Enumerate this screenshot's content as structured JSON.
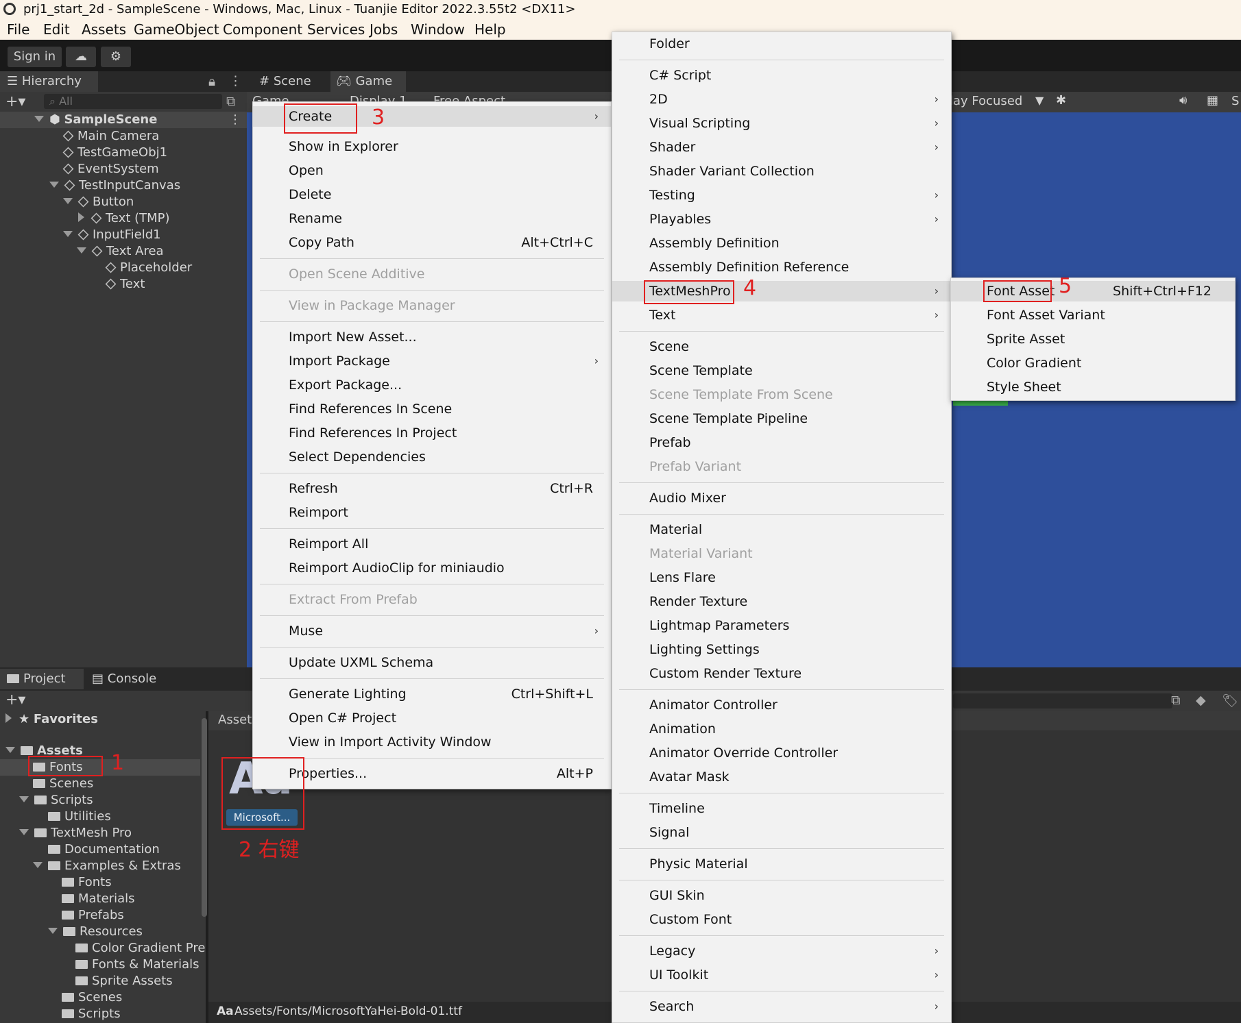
{
  "window": {
    "title": "prj1_start_2d - SampleScene - Windows, Mac, Linux - Tuanjie Editor 2022.3.55t2 <DX11>"
  },
  "menubar": [
    "File",
    "Edit",
    "Assets",
    "GameObject",
    "Component",
    "Services",
    "Jobs",
    "Window",
    "Help"
  ],
  "toolbar": {
    "sign_in": "Sign in"
  },
  "hierarchy": {
    "tab": "Hierarchy",
    "search_placeholder": "All",
    "items": [
      "SampleScene",
      "Main Camera",
      "TestGameObj1",
      "EventSystem",
      "TestInputCanvas",
      "Button",
      "Text (TMP)",
      "InputField1",
      "Text Area",
      "Placeholder",
      "Text"
    ]
  },
  "scene_tabs": {
    "scene": "Scene",
    "game": "Game",
    "game_dropdown": "Game",
    "display": "Display 1",
    "aspect": "Free Aspect",
    "play_focused": "lay Focused",
    "s": "S"
  },
  "project": {
    "tabs": [
      "Project",
      "Console"
    ],
    "favorites": "Favorites",
    "tree": [
      "Assets",
      "Fonts",
      "Scenes",
      "Scripts",
      "Utilities",
      "TextMesh Pro",
      "Documentation",
      "Examples & Extras",
      "Fonts",
      "Materials",
      "Prefabs",
      "Resources",
      "Color Gradient Pre",
      "Fonts & Materials",
      "Sprite Assets",
      "Scenes",
      "Scripts"
    ],
    "breadcrumb": "Asset",
    "asset_glyph": "Aa",
    "asset_name": "Microsoft...",
    "status_icon": "Aa",
    "status_path": "Assets/Fonts/MicrosoftYaHei-Bold-01.ttf"
  },
  "context_menu": {
    "items": [
      {
        "label": "Create",
        "arrow": true
      },
      {
        "label": "Show in Explorer"
      },
      {
        "label": "Open"
      },
      {
        "label": "Delete"
      },
      {
        "label": "Rename"
      },
      {
        "label": "Copy Path",
        "shortcut": "Alt+Ctrl+C"
      },
      {
        "label": "Open Scene Additive",
        "disabled": true
      },
      {
        "label": "View in Package Manager",
        "disabled": true
      },
      {
        "label": "Import New Asset..."
      },
      {
        "label": "Import Package",
        "arrow": true
      },
      {
        "label": "Export Package..."
      },
      {
        "label": "Find References In Scene"
      },
      {
        "label": "Find References In Project"
      },
      {
        "label": "Select Dependencies"
      },
      {
        "label": "Refresh",
        "shortcut": "Ctrl+R"
      },
      {
        "label": "Reimport"
      },
      {
        "label": "Reimport All"
      },
      {
        "label": "Reimport AudioClip for miniaudio"
      },
      {
        "label": "Extract From Prefab",
        "disabled": true
      },
      {
        "label": "Muse",
        "arrow": true
      },
      {
        "label": "Update UXML Schema"
      },
      {
        "label": "Generate Lighting",
        "shortcut": "Ctrl+Shift+L"
      },
      {
        "label": "Open C# Project"
      },
      {
        "label": "View in Import Activity Window"
      },
      {
        "label": "Properties...",
        "shortcut": "Alt+P"
      }
    ]
  },
  "create_menu": {
    "items": [
      {
        "label": "Folder"
      },
      {
        "label": "C# Script"
      },
      {
        "label": "2D",
        "arrow": true
      },
      {
        "label": "Visual Scripting",
        "arrow": true
      },
      {
        "label": "Shader",
        "arrow": true
      },
      {
        "label": "Shader Variant Collection"
      },
      {
        "label": "Testing",
        "arrow": true
      },
      {
        "label": "Playables",
        "arrow": true
      },
      {
        "label": "Assembly Definition"
      },
      {
        "label": "Assembly Definition Reference"
      },
      {
        "label": "TextMeshPro",
        "arrow": true
      },
      {
        "label": "Text",
        "arrow": true
      },
      {
        "label": "Scene"
      },
      {
        "label": "Scene Template"
      },
      {
        "label": "Scene Template From Scene",
        "disabled": true
      },
      {
        "label": "Scene Template Pipeline"
      },
      {
        "label": "Prefab"
      },
      {
        "label": "Prefab Variant",
        "disabled": true
      },
      {
        "label": "Audio Mixer"
      },
      {
        "label": "Material"
      },
      {
        "label": "Material Variant",
        "disabled": true
      },
      {
        "label": "Lens Flare"
      },
      {
        "label": "Render Texture"
      },
      {
        "label": "Lightmap Parameters"
      },
      {
        "label": "Lighting Settings"
      },
      {
        "label": "Custom Render Texture"
      },
      {
        "label": "Animator Controller"
      },
      {
        "label": "Animation"
      },
      {
        "label": "Animator Override Controller"
      },
      {
        "label": "Avatar Mask"
      },
      {
        "label": "Timeline"
      },
      {
        "label": "Signal"
      },
      {
        "label": "Physic Material"
      },
      {
        "label": "GUI Skin"
      },
      {
        "label": "Custom Font"
      },
      {
        "label": "Legacy",
        "arrow": true
      },
      {
        "label": "UI Toolkit",
        "arrow": true
      },
      {
        "label": "Search",
        "arrow": true
      }
    ]
  },
  "tmp_menu": {
    "items": [
      {
        "label": "Font Asset",
        "shortcut": "Shift+Ctrl+F12"
      },
      {
        "label": "Font Asset Variant"
      },
      {
        "label": "Sprite Asset"
      },
      {
        "label": "Color Gradient"
      },
      {
        "label": "Style Sheet"
      }
    ]
  },
  "annotations": {
    "n1": "1",
    "n2": "2 右键",
    "n3": "3",
    "n4": "4",
    "n5": "5"
  },
  "colors": {
    "accent_red": "#e02020",
    "game_view_blue": "#2e4f9b",
    "menu_bg": "#f2f2f2",
    "selection_blue": "#2c5d87"
  }
}
